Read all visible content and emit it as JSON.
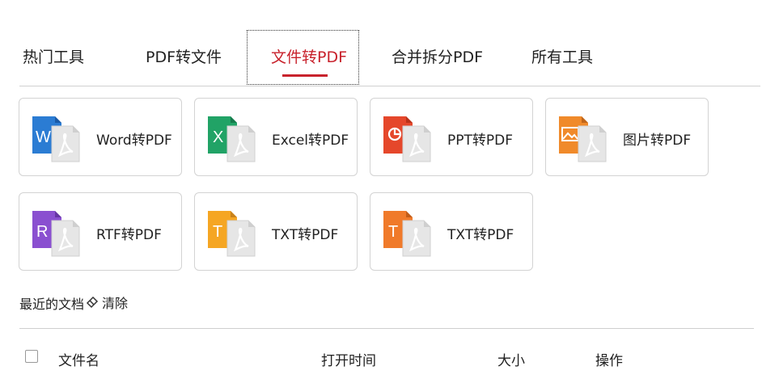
{
  "tabs": [
    {
      "label": "热门工具",
      "active": false
    },
    {
      "label": "PDF转文件",
      "active": false
    },
    {
      "label": "文件转PDF",
      "active": true
    },
    {
      "label": "合并拆分PDF",
      "active": false
    },
    {
      "label": "所有工具",
      "active": false
    }
  ],
  "colors": {
    "accent": "#c8222c"
  },
  "cards": [
    {
      "label": "Word转PDF",
      "icon": "word-doc-icon",
      "letter": "W",
      "color": "#2b7cd3"
    },
    {
      "label": "Excel转PDF",
      "icon": "excel-doc-icon",
      "letter": "X",
      "color": "#21a366"
    },
    {
      "label": "PPT转PDF",
      "icon": "ppt-doc-icon",
      "letter": "",
      "color": "#e5472b"
    },
    {
      "label": "图片转PDF",
      "icon": "image-doc-icon",
      "letter": "",
      "color": "#f08a2a"
    },
    {
      "label": "RTF转PDF",
      "icon": "rtf-doc-icon",
      "letter": "R",
      "color": "#8a4fd0"
    },
    {
      "label": "TXT转PDF",
      "icon": "txt-doc-icon",
      "letter": "T",
      "color": "#f5a623"
    },
    {
      "label": "TXT转PDF",
      "icon": "txt-doc-icon",
      "letter": "T",
      "color": "#f07a2a"
    }
  ],
  "recent": {
    "title": "最近的文档",
    "clear_label": "清除"
  },
  "table": {
    "columns": [
      "文件名",
      "打开时间",
      "大小",
      "操作"
    ]
  }
}
